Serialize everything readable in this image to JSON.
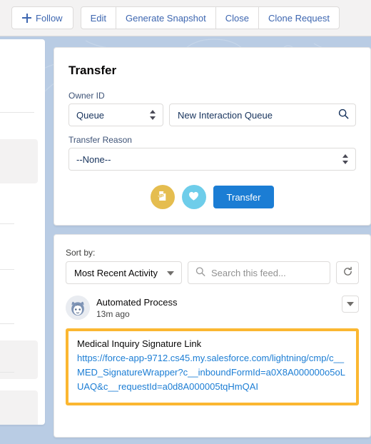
{
  "actionbar": {
    "follow_label": "Follow",
    "follow_icon": "plus-icon",
    "buttons": [
      {
        "label": "Edit"
      },
      {
        "label": "Generate Snapshot"
      },
      {
        "label": "Close"
      },
      {
        "label": "Clone Request"
      }
    ]
  },
  "transfer": {
    "title": "Transfer",
    "owner_label": "Owner ID",
    "owner_type_value": "Queue",
    "owner_lookup_value": "New Interaction Queue",
    "owner_lookup_icon": "search-icon",
    "reason_label": "Transfer Reason",
    "reason_value": "--None--",
    "action_icon_1": "document-transfer-icon",
    "action_icon_2": "heart-icon",
    "submit_label": "Transfer",
    "accent_color": "#1b7dd4",
    "icon1_color": "#e5bd4f",
    "icon2_color": "#6ecdea"
  },
  "feed": {
    "sort_label": "Sort by:",
    "sort_value": "Most Recent Activity",
    "search_placeholder": "Search this feed...",
    "search_value": "",
    "search_icon": "search-icon",
    "refresh_icon": "refresh-icon",
    "item": {
      "avatar_icon": "astro-avatar-icon",
      "author": "Automated Process",
      "timestamp": "13m ago",
      "menu_icon": "chevron-down-icon",
      "post_title": "Medical Inquiry Signature Link",
      "post_link": "https://force-app-9712.cs45.my.salesforce.com/lightning/cmp/c__MED_SignatureWrapper?c__inboundFormId=a0X8A000000o5oLUAQ&c__requestId=a0d8A000005tqHmQAI",
      "highlight_color": "#fbb731"
    }
  },
  "theme": {
    "page_background": "#b9cce4",
    "toolbar_background": "#f3f2f2",
    "link_color": "#1b7dd4"
  }
}
